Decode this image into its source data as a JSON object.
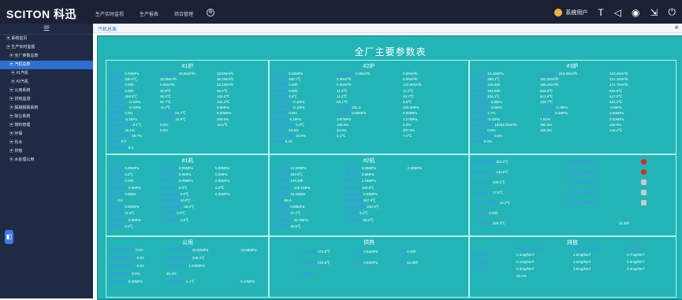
{
  "header": {
    "logo": "SCITON 科迅",
    "nav": [
      "生产实时监视",
      "生产报表",
      "综合管理"
    ],
    "nav_plus": "⊕",
    "user": "系统用户",
    "tool_icons": [
      "T",
      "◁",
      "◉",
      "⇲",
      "⏻"
    ]
  },
  "sidebar": {
    "toggle": "☰",
    "items": [
      {
        "label": "系统首页",
        "level": 0,
        "active": false
      },
      {
        "label": "生产实时监视",
        "level": 0,
        "active": false
      },
      {
        "label": "全厂参数总表",
        "level": 1,
        "active": false
      },
      {
        "label": "汽机总表",
        "level": 1,
        "active": true
      },
      {
        "label": "#1汽机",
        "level": 2,
        "active": false
      },
      {
        "label": "#2汽机",
        "level": 2,
        "active": false
      },
      {
        "label": "公用系统",
        "level": 1,
        "active": false
      },
      {
        "label": "供热监测",
        "level": 1,
        "active": false
      },
      {
        "label": "脱硫脱硝系统",
        "level": 1,
        "active": false
      },
      {
        "label": "除尘系统",
        "level": 1,
        "active": false
      },
      {
        "label": "燃料管理",
        "level": 1,
        "active": false
      },
      {
        "label": "环保",
        "level": 1,
        "active": false
      },
      {
        "label": "化水",
        "level": 1,
        "active": false
      },
      {
        "label": "供热",
        "level": 1,
        "active": false
      },
      {
        "label": "水处理公用",
        "level": 1,
        "active": false
      }
    ],
    "float_button": "◧"
  },
  "tabs": {
    "active": "汽机总表",
    "close": "⊗"
  },
  "screen": {
    "title": "全厂主要参数表",
    "boiler1": {
      "title": "#1炉",
      "left": [
        [
          "主汽压力",
          "0.00MPa"
        ],
        [
          "主汽温度",
          "536.6℃"
        ],
        [
          "主汽流量",
          "0.0t/h"
        ],
        [
          "给水流量",
          "0.0t/h"
        ],
        [
          "给水温度",
          "104.6℃"
        ],
        [
          "一次风压力",
          "-0.1kPa"
        ],
        [
          "二次风压力",
          "-0.1kPa"
        ],
        [
          "排烟氧量",
          "0.0%"
        ],
        [
          "炉膛负压",
          "-0.1kPa"
        ],
        [
          "低过出口温度",
          "-0.1℃"
        ],
        [
          "汽包水位",
          "20.1%"
        ],
        [
          "高过出口温度",
          "20.7%"
        ],
        [
          "给煤量",
          "0.0"
        ],
        [
          "送风机电流",
          "0.0"
        ]
      ],
      "mid": [
        [
          "省煤器出口",
          "25.6Nm³/h"
        ],
        [
          "",
          "32.9Nm³/h"
        ],
        [
          "",
          "0.0Nm³/h"
        ],
        [
          "",
          "32.9℃"
        ],
        [
          "",
          "35.9℃"
        ],
        [
          "",
          "91.7℃"
        ],
        [
          "",
          "-0.1℃"
        ],
        [
          "一次风温",
          "54.7℃"
        ],
        [
          "二次风温",
          "15.9℃"
        ],
        [
          "",
          "0.0%"
        ],
        [
          "",
          "0.0%"
        ]
      ],
      "right": [
        [
          "",
          "33.5Nm³/h"
        ],
        [
          "",
          "36.2Nm³/h"
        ],
        [
          "",
          "33.1Nm³/h"
        ],
        [
          "",
          "35.2℃"
        ],
        [
          "",
          "100.9℃"
        ],
        [
          "",
          "104.2℃"
        ],
        [
          "",
          "0.0MPa"
        ],
        [
          "",
          "0.00MPa"
        ],
        [
          "",
          "200.0%"
        ],
        [
          "",
          "10.6℃"
        ]
      ]
    },
    "boiler2": {
      "title": "#2炉",
      "left": [
        [
          "主汽压力",
          "0.02MPa"
        ],
        [
          "主汽温度",
          "500.7℃"
        ],
        [
          "主汽流量",
          "0.0t/h"
        ],
        [
          "给水流量",
          "0.8t/h"
        ],
        [
          "给水温度",
          "0.8℃"
        ],
        [
          "一次风压力",
          "-0.1kPa"
        ],
        [
          "二次风压力",
          "-0.1kPa"
        ],
        [
          "排烟氧量",
          "0.0%"
        ],
        [
          "炉膛负压",
          "-0.1kPa"
        ],
        [
          "低过出口温度",
          "0.0℃"
        ],
        [
          "汽包水位",
          "53.5%"
        ],
        [
          "高过出口温度",
          "23.9%"
        ],
        [
          "给煤量",
          "0.15"
        ]
      ],
      "mid": [
        [
          "省煤器出口",
          "0.0Nm³/h"
        ],
        [
          "",
          "0.0Nm³/h"
        ],
        [
          "",
          "0.0Nm³/h"
        ],
        [
          "",
          "11.3℃"
        ],
        [
          "",
          "11.2℃"
        ],
        [
          "",
          "50.1℃"
        ],
        [
          "一次风温",
          "261.3"
        ],
        [
          "二次风温",
          "0.00MPa"
        ],
        [
          "",
          "0.67MPa"
        ],
        [
          "",
          "199.0%"
        ],
        [
          "",
          "33.0%"
        ],
        [
          "",
          "0.1℃"
        ]
      ],
      "right": [
        [
          "",
          "0.0Nm³/h"
        ],
        [
          "",
          "0.0Nm³/h"
        ],
        [
          "",
          "120.9Nm³/h"
        ],
        [
          "",
          "11.2℃"
        ],
        [
          "",
          "10.7℃"
        ],
        [
          "",
          "9.5℃"
        ],
        [
          "",
          "226.3MPa"
        ],
        [
          "",
          "0.00MPa"
        ],
        [
          "",
          "1.27MPa"
        ],
        [
          "",
          "2.0%"
        ],
        [
          "",
          "207.0%"
        ],
        [
          "",
          "7.1℃"
        ]
      ]
    },
    "boiler3": {
      "title": "#3炉",
      "left": [
        [
          "主汽压力",
          "12.42MPa"
        ],
        [
          "主汽温度",
          "498.1℃"
        ],
        [
          "主汽流量",
          "145.8t/h"
        ],
        [
          "给水流量",
          "153.5t/h"
        ],
        [
          "给水温度",
          "216.1℃"
        ],
        [
          "一次风压力",
          "3.8kPa"
        ],
        [
          "二次风压力",
          "4.0kPa"
        ],
        [
          "排烟氧量",
          "1.7%"
        ],
        [
          "炉膛负压",
          "-0.1kPa"
        ],
        [
          "低过出口温度",
          "18262.2Nm³/h"
        ],
        [
          "汽包水位",
          "0.0%"
        ],
        [
          "高过出口温度",
          "0.0%"
        ],
        [
          "给煤量",
          "5.6%"
        ]
      ],
      "mid": [
        [
          "省煤器出口",
          "210.3Nm³/h"
        ],
        [
          "",
          "162.2Nm³/h"
        ],
        [
          "",
          "165.2Nm³/h"
        ],
        [
          "",
          "520.0℃"
        ],
        [
          "",
          "513.6℃"
        ],
        [
          "",
          "330.7℃"
        ],
        [
          "一次风温",
          "-2.7kPa"
        ],
        [
          "二次风温",
          "5.6MPa"
        ],
        [
          "",
          "7.52%"
        ],
        [
          "",
          "152.0%"
        ],
        [
          "",
          "100.3%"
        ]
      ],
      "right": [
        [
          "",
          "210.4Nm³/h"
        ],
        [
          "",
          "214.1Nm³/h"
        ],
        [
          "",
          "172.7Nm³/h"
        ],
        [
          "",
          "542.5℃"
        ],
        [
          "",
          "547.9℃"
        ],
        [
          "",
          "521.2℃"
        ],
        [
          "",
          "-4.6kPa"
        ],
        [
          "",
          "4.80MPa"
        ],
        [
          "",
          "0.00MPa"
        ],
        [
          "",
          "165.0%"
        ],
        [
          "",
          "145.4℃"
        ]
      ]
    },
    "turbine1": {
      "title": "#1机",
      "left": [
        [
          "主汽压力",
          "0.00MPa"
        ],
        [
          "主汽温度",
          "0.0℃"
        ],
        [
          "主汽流量",
          "0.0t/h"
        ],
        [
          "调节级压力",
          "0.0MPa"
        ],
        [
          "发电负荷",
          "0.0MW"
        ],
        [
          "真空",
          "0.0"
        ],
        [
          "排汽温度",
          "0.00MPa"
        ],
        [
          "凝结水温",
          "11.6℃"
        ],
        [
          "凝汽器压力",
          "0.0MPa"
        ],
        [
          "回热温度",
          "0.0℃"
        ]
      ],
      "mid": [
        [
          "1抽汽压力",
          "0.00MPa"
        ],
        [
          "2抽汽压力",
          "0.0MPa"
        ],
        [
          "3抽汽压力",
          "0.00MPa"
        ],
        [
          "4抽汽压力",
          "0.0℃"
        ],
        [
          "除氧器压力",
          "0.0℃"
        ],
        [
          "除氧器温度",
          "10.0℃"
        ],
        [
          "高加出口温度",
          "35.0℃"
        ],
        [
          "汽机转速",
          "0.0℃"
        ],
        [
          "汽轮机振动",
          "1.6℃"
        ]
      ],
      "right": [
        [
          "",
          "0.00MPa"
        ],
        [
          "",
          "0.0MPa"
        ],
        [
          "",
          "0.00MPa"
        ],
        [
          "",
          "0.0℃"
        ],
        [
          "",
          "0.00MPa"
        ]
      ]
    },
    "turbine2": {
      "title": "#2机",
      "left": [
        [
          "主汽压力",
          "12.33MPa"
        ],
        [
          "主汽温度",
          "493.9℃"
        ],
        [
          "主汽流量",
          "143.4t/h"
        ],
        [
          "调节级压力",
          "120.1MPa"
        ],
        [
          "发电负荷",
          "15.23MW"
        ],
        [
          "真空",
          "-95.4"
        ],
        [
          "排汽温度",
          "0.00MPa"
        ],
        [
          "凝结水温",
          "47.2℃"
        ],
        [
          "凝汽器压力",
          "16.7MPa"
        ],
        [
          "回热温度",
          "45.5℃"
        ]
      ],
      "mid": [
        [
          "1抽汽压力",
          "5.05MPa"
        ],
        [
          "2抽汽压力",
          "2.8MPa"
        ],
        [
          "3抽汽压力",
          "1.18MPa"
        ],
        [
          "4抽汽压力",
          "160.9℃"
        ],
        [
          "除氧器压力",
          "0.53MPa"
        ],
        [
          "除氧器温度",
          "167.9℃"
        ],
        [
          "高加出口温度",
          "210.3℃"
        ],
        [
          "汽机转速",
          "6.2℃"
        ],
        [
          "汽轮机振动",
          "55.5℃"
        ]
      ],
      "right": [
        [
          "",
          "0.00MPa"
        ]
      ]
    },
    "status": {
      "rows": [
        [
          "给水母管温度",
          "113.2℃",
          "#1炉汽包水位高报警",
          "red"
        ],
        [
          "给水母管压力",
          "143.8℃",
          "#1炉汽包水位低报警",
          "red"
        ],
        [
          "除氧器温度",
          "120.1℃",
          "#2炉汽包水位高报警",
          "gray"
        ],
        [
          "除氧器压力",
          "17.6℃",
          "#2炉汽包水位低报警",
          "gray"
        ],
        [
          "主蒸汽母管温度",
          "13.2℃",
          "#3炉汽包水位高报警",
          "gray"
        ],
        [
          "母管流量",
          "0.0t/h",
          "",
          ""
        ],
        [
          "工业水温度",
          "226.3℃",
          "",
          "11.4t/h"
        ]
      ]
    },
    "public": {
      "title": "公用",
      "rows": [
        [
          "#1除盐水泵电流",
          "0.0A",
          "除盐水母管压力",
          "10.52MPa",
          "",
          "16.56MPa"
        ],
        [
          "#2除盐水泵电流",
          "-0.0A",
          "除盐水母管温度",
          "129.3℃",
          ""
        ],
        [
          "#3除盐水泵电流",
          "-0.0A",
          "除盐水箱液位",
          "1.529MPa",
          ""
        ],
        [
          "除盐水箱液位",
          "0.0%",
          "",
          "26.2%",
          ""
        ],
        [
          "循环水压力",
          "0.00MPa",
          "循环水温度",
          "-1.1℃",
          "",
          "0.12MPa"
        ]
      ]
    },
    "heating": {
      "title": "供热",
      "rows": [
        [
          "PRV1阀位",
          "173.8℃",
          "压力",
          "0.84MPa",
          "流量",
          "0.0t/h"
        ],
        [
          "PRV2阀位",
          "224.8℃",
          "压力",
          "0.84MPa",
          "流量",
          "61.8t/h"
        ],
        [
          "总供热量",
          "",
          "",
          "",
          "",
          ""
        ]
      ]
    },
    "emission": {
      "title": "排放",
      "headers": [
        "",
        "烟囱SO2排放浓度",
        "烟囱NOx排放浓度",
        "烟尘浓度"
      ],
      "rows": [
        [
          "#1炉排放",
          "0.1mg/Nm³",
          "2.5mg/Nm³",
          "0.7mg/Nm³"
        ],
        [
          "#2炉排放",
          "0.1mg/Nm³",
          "1.3mg/Nm³",
          "2.5mg/Nm³"
        ],
        [
          "#3炉排放",
          "0.3mg/Nm³",
          "3.8mg/Nm³",
          "3.2mg/Nm³"
        ],
        [
          "",
          "28.2%",
          "",
          ""
        ]
      ]
    }
  }
}
